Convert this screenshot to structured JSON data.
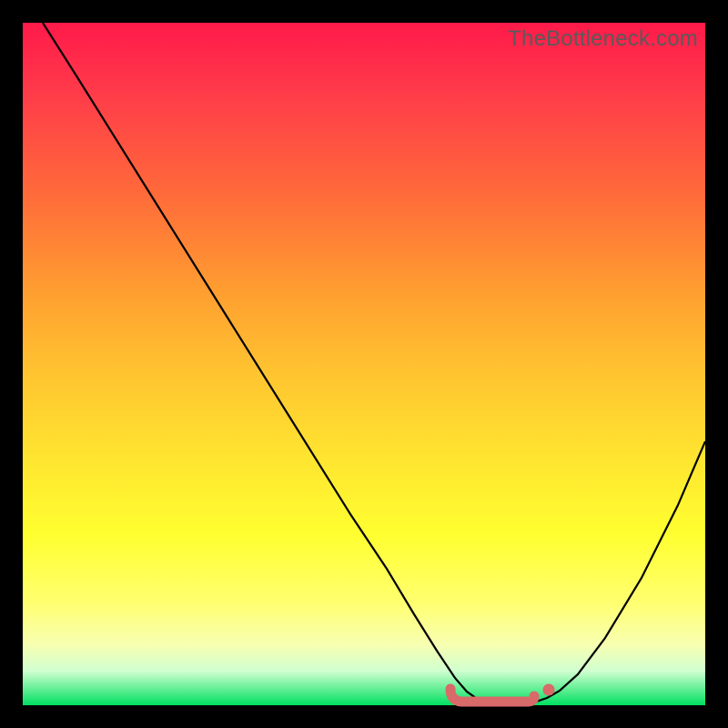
{
  "watermark": "TheBottleneck.com",
  "colors": {
    "frame": "#000000",
    "curve": "#000000",
    "marker_stroke": "#d86a6a",
    "marker_fill": "#d86a6a",
    "gradient_top": "#ff1a4a",
    "gradient_bottom": "#00e060"
  },
  "chart_data": {
    "type": "line",
    "title": "",
    "xlabel": "",
    "ylabel": "",
    "xlim": [
      0,
      100
    ],
    "ylim": [
      0,
      100
    ],
    "grid": false,
    "x": [
      0,
      5,
      10,
      15,
      20,
      25,
      30,
      35,
      40,
      45,
      50,
      55,
      60,
      62,
      65,
      68,
      70,
      72,
      74,
      76,
      78,
      80,
      85,
      90,
      95,
      100
    ],
    "series": [
      {
        "name": "bottleneck-curve",
        "values": [
          100,
          92,
          84,
          76,
          68,
          60,
          52,
          44,
          36,
          28,
          20,
          13,
          7,
          5,
          2.5,
          1,
          0.5,
          0.3,
          0.3,
          0.5,
          1.2,
          3,
          10,
          22,
          36,
          53
        ]
      }
    ],
    "annotations": [
      {
        "name": "optimal-range-marker",
        "x_start": 62,
        "x_end": 76,
        "y": 0.5
      }
    ]
  }
}
